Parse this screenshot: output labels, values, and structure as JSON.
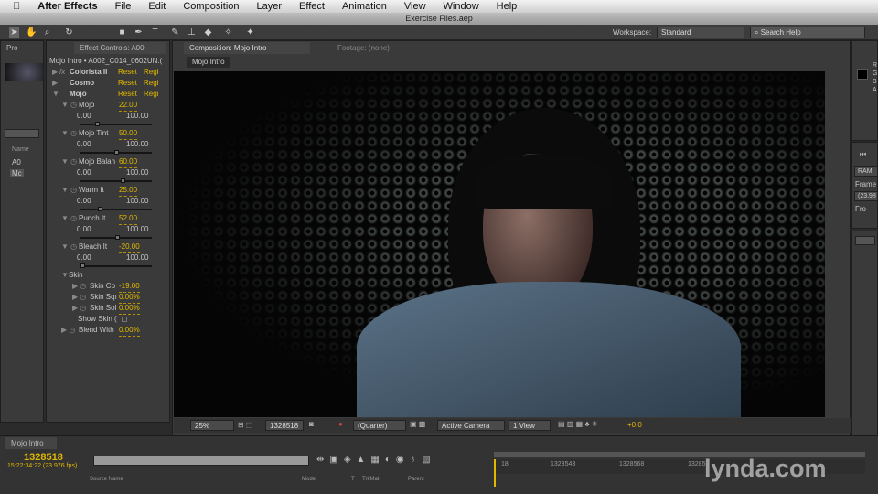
{
  "menubar": {
    "app": "After Effects",
    "items": [
      "File",
      "Edit",
      "Composition",
      "Layer",
      "Effect",
      "Animation",
      "View",
      "Window",
      "Help"
    ]
  },
  "window_title": "Exercise Files.aep",
  "toolbar": {
    "workspace_label": "Workspace:",
    "workspace_value": "Standard",
    "search_placeholder": "Search Help"
  },
  "project": {
    "tab": "Pro",
    "name_header": "Name",
    "items": [
      "A0",
      "Mc"
    ]
  },
  "effect_controls": {
    "tab": "Effect Controls: A00",
    "header": "Mojo Intro • A002_C014_0602UN.(",
    "effects": [
      {
        "name": "Colorista II",
        "reset": "Reset",
        "reg": "Regi"
      },
      {
        "name": "Cosmo",
        "reset": "Reset",
        "reg": "Regi"
      },
      {
        "name": "Mojo",
        "reset": "Reset",
        "reg": "Regi"
      }
    ],
    "params": [
      {
        "name": "Mojo",
        "value": "22.00",
        "min": "0.00",
        "max": "100.00",
        "pos": 0.22
      },
      {
        "name": "Mojo Tint",
        "value": "50.00",
        "min": "0.00",
        "max": "100.00",
        "pos": 0.5
      },
      {
        "name": "Mojo Balan",
        "value": "60.00",
        "min": "0.00",
        "max": "100.00",
        "pos": 0.6
      },
      {
        "name": "Warm It",
        "value": "25.00",
        "min": "0.00",
        "max": "100.00",
        "pos": 0.25
      },
      {
        "name": "Punch It",
        "value": "52.00",
        "min": "0.00",
        "max": "100.00",
        "pos": 0.52
      },
      {
        "name": "Bleach It",
        "value": "-20.00",
        "min": "0.00",
        "max": "100.00",
        "pos": 0.0
      }
    ],
    "skin": {
      "label": "Skin",
      "items": [
        {
          "name": "Skin Co",
          "value": "-19.00"
        },
        {
          "name": "Skin Sqı",
          "value": "0.00%"
        },
        {
          "name": "Skin Sol",
          "value": "0.00%"
        }
      ],
      "show_skin": "Show Skin ("
    },
    "blend": {
      "name": "Blend With",
      "value": "0.00%"
    }
  },
  "composition": {
    "tab": "Composition: Mojo Intro",
    "footage_tab": "Footage: (none)",
    "breadcrumb": "Mojo Intro",
    "zoom": "25%",
    "timecode": "1328518",
    "resolution": "(Quarter)",
    "camera": "Active Camera",
    "views": "1 View",
    "exposure": "+0.0"
  },
  "info": {
    "labels": [
      "R",
      "G",
      "B",
      "A"
    ]
  },
  "preview": {
    "ram": "RAM",
    "frame": "Frame",
    "rate": "(23.98",
    "from": "Fro"
  },
  "timeline": {
    "tab": "Mojo Intro",
    "timecode": "1328518",
    "timecode_sub": "15:22:34:22 (23.976 fps)",
    "columns": {
      "source": "Source Name",
      "mode": "Mode",
      "t": "T",
      "trkmat": "TrkMat",
      "parent": "Parent"
    },
    "ruler": [
      "18",
      "1328543",
      "1328568",
      "13285"
    ]
  },
  "watermark": "lynda.com"
}
